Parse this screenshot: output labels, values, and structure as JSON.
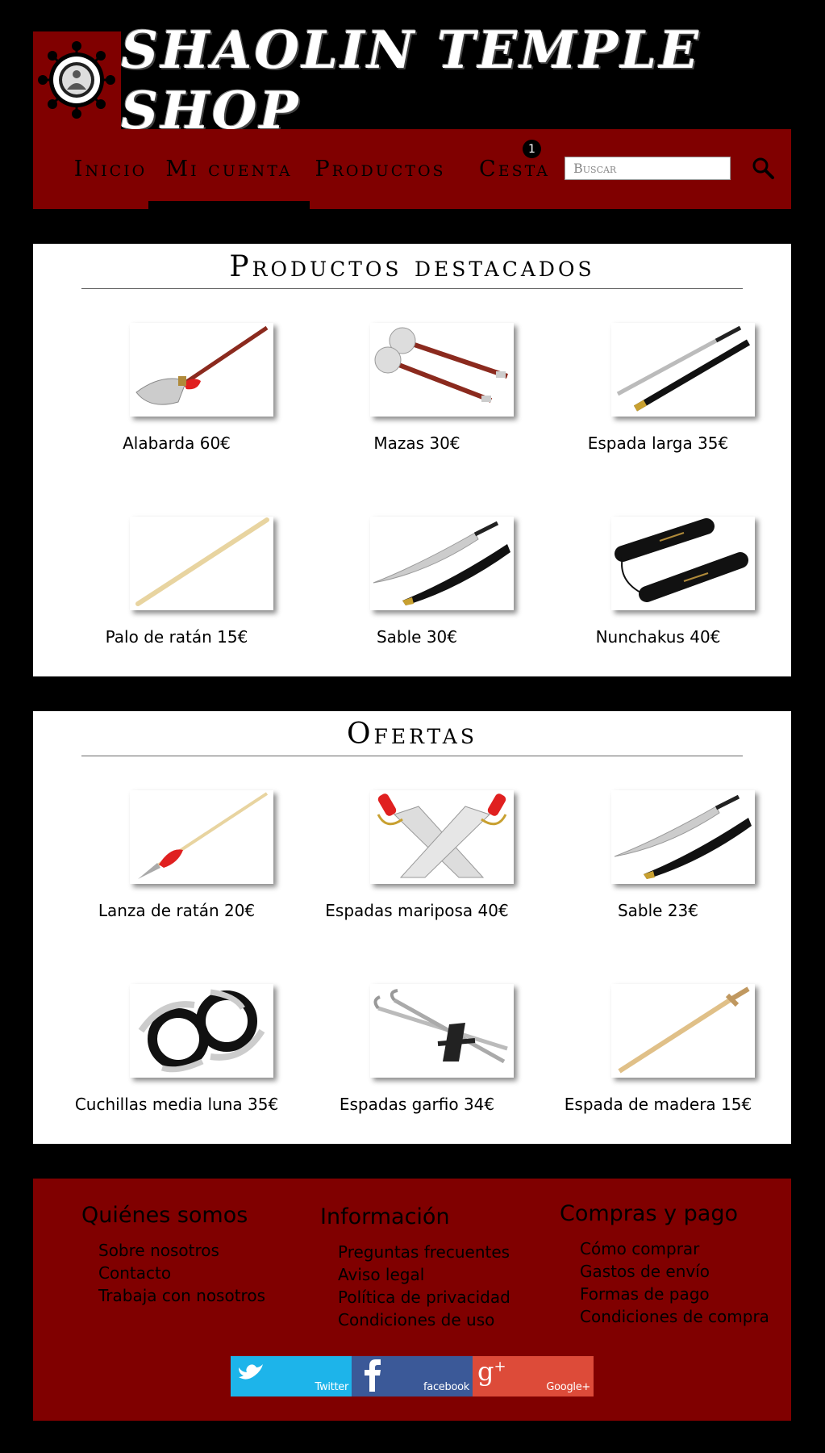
{
  "header": {
    "site_title": "Shaolin Temple Shop",
    "colors": {
      "brand": "#800000",
      "background": "#000000"
    }
  },
  "nav": {
    "items": [
      {
        "label": "Inicio"
      },
      {
        "label": "Mi cuenta",
        "active": true
      },
      {
        "label": "Productos"
      },
      {
        "label": "Cesta"
      }
    ],
    "cart_count": "1",
    "search_placeholder": "Buscar",
    "search_icon": "search-icon"
  },
  "featured": {
    "title": "Productos destacados",
    "products": [
      {
        "caption": "Alabarda 60€",
        "icon": "halberd-image"
      },
      {
        "caption": "Mazas 30€",
        "icon": "maces-image"
      },
      {
        "caption": "Espada larga 35€",
        "icon": "long-sword-image"
      },
      {
        "caption": "Palo de ratán 15€",
        "icon": "rattan-stick-image"
      },
      {
        "caption": "Sable 30€",
        "icon": "sabre-image"
      },
      {
        "caption": "Nunchakus 40€",
        "icon": "nunchaku-image"
      }
    ]
  },
  "offers": {
    "title": "Ofertas",
    "products": [
      {
        "caption": "Lanza de ratán 20€",
        "icon": "rattan-spear-image"
      },
      {
        "caption": "Espadas mariposa 40€",
        "icon": "butterfly-swords-image"
      },
      {
        "caption": "Sable 23€",
        "icon": "sabre-image"
      },
      {
        "caption": "Cuchillas media luna 35€",
        "icon": "half-moon-blades-image"
      },
      {
        "caption": "Espadas garfio 34€",
        "icon": "hook-swords-image"
      },
      {
        "caption": "Espada de madera 15€",
        "icon": "wooden-sword-image"
      }
    ]
  },
  "footer": {
    "about": {
      "title": "Quiénes somos",
      "links": [
        "Sobre nosotros",
        "Contacto",
        "Trabaja con nosotros"
      ]
    },
    "info": {
      "title": "Información",
      "links": [
        "Preguntas frecuentes",
        "Aviso legal",
        "Política de privacidad",
        "Condiciones de uso"
      ]
    },
    "buy": {
      "title": "Compras y pago",
      "links": [
        "Cómo comprar",
        "Gastos de envío",
        "Formas de pago",
        "Condiciones de compra"
      ]
    },
    "social": [
      {
        "label": "Twitter",
        "color": "#1db4ea"
      },
      {
        "label": "facebook",
        "color": "#3b5998"
      },
      {
        "label": "Google+",
        "color": "#dd4b39"
      }
    ]
  }
}
